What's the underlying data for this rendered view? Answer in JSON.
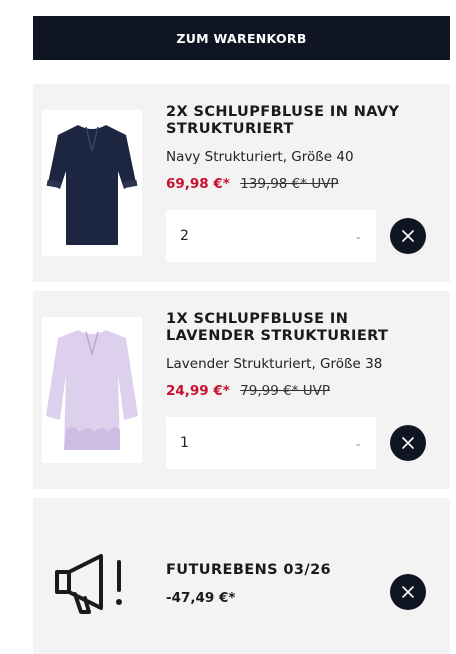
{
  "cart_button": {
    "label": "ZUM WARENKORB"
  },
  "items": [
    {
      "title": "2X SCHLUPFBLUSE IN NAVY STRUKTURIERT",
      "variant": "Navy Strukturiert, Größe 40",
      "price": "69,98 €*",
      "old_price": "139,98 €* UVP",
      "quantity": "2",
      "color": "#1d2640"
    },
    {
      "title": "1X SCHLUPFBLUSE IN LAVENDER STRUKTURIERT",
      "variant": "Lavender Strukturiert, Größe 38",
      "price": "24,99 €*",
      "old_price": "79,99 €* UVP",
      "quantity": "1",
      "color": "#ddd0ec"
    }
  ],
  "coupon": {
    "title": "FUTUREBENS 03/26",
    "amount": "-47,49 €*",
    "icon": "megaphone-icon"
  },
  "colors": {
    "accent_dark": "#0f1522",
    "sale_red": "#c8102e",
    "card_bg": "#f3f3f3"
  }
}
